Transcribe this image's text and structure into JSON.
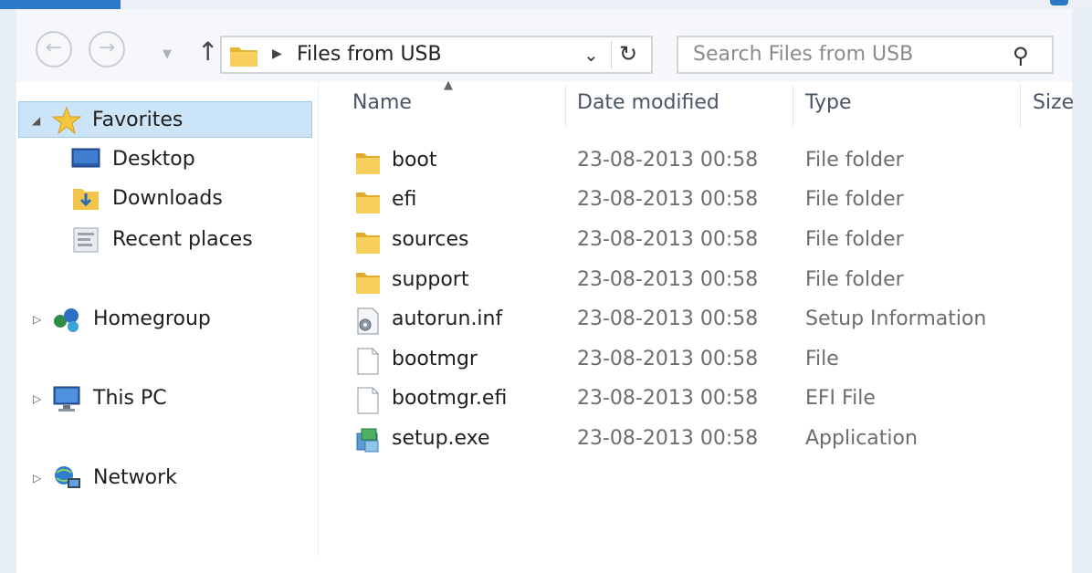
{
  "address_bar": {
    "back_icon": "back-arrow-icon",
    "forward_icon": "forward-arrow-icon",
    "up_icon": "up-arrow-icon",
    "path_label": "Files from USB",
    "refresh_icon": "refresh-icon"
  },
  "search": {
    "placeholder": "Search Files from USB",
    "icon": "search-icon"
  },
  "navigation": {
    "favorites": {
      "label": "Favorites",
      "items": [
        {
          "label": "Desktop",
          "icon": "desktop-icon"
        },
        {
          "label": "Downloads",
          "icon": "downloads-icon"
        },
        {
          "label": "Recent places",
          "icon": "recent-places-icon"
        }
      ]
    },
    "homegroup": {
      "label": "Homegroup",
      "icon": "homegroup-icon"
    },
    "this_pc": {
      "label": "This PC",
      "icon": "computer-icon"
    },
    "network": {
      "label": "Network",
      "icon": "network-icon"
    }
  },
  "columns": {
    "name": "Name",
    "date_modified": "Date modified",
    "type": "Type",
    "size": "Size"
  },
  "files": [
    {
      "name": "boot",
      "date": "23-08-2013 00:58",
      "type": "File folder",
      "icon": "folder-icon"
    },
    {
      "name": "efi",
      "date": "23-08-2013 00:58",
      "type": "File folder",
      "icon": "folder-icon"
    },
    {
      "name": "sources",
      "date": "23-08-2013 00:58",
      "type": "File folder",
      "icon": "folder-icon"
    },
    {
      "name": "support",
      "date": "23-08-2013 00:58",
      "type": "File folder",
      "icon": "folder-icon"
    },
    {
      "name": "autorun.inf",
      "date": "23-08-2013 00:58",
      "type": "Setup Information",
      "icon": "setup-info-file-icon"
    },
    {
      "name": "bootmgr",
      "date": "23-08-2013 00:58",
      "type": "File",
      "icon": "file-icon"
    },
    {
      "name": "bootmgr.efi",
      "date": "23-08-2013 00:58",
      "type": "EFI File",
      "icon": "file-icon"
    },
    {
      "name": "setup.exe",
      "date": "23-08-2013 00:58",
      "type": "Application",
      "icon": "application-icon"
    }
  ],
  "colors": {
    "accent": "#2a78c7",
    "selection": "#cce4f7",
    "folder": "#f2c54a"
  }
}
